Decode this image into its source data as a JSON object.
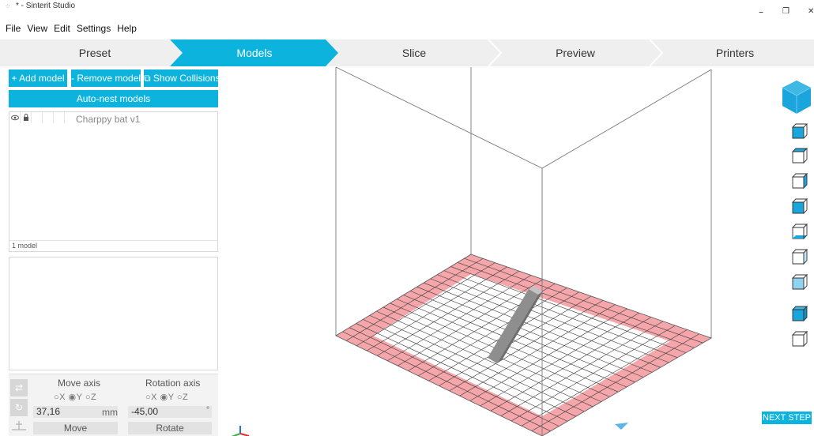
{
  "window": {
    "title": "* - Sinterit Studio",
    "app_icon": "app-icon",
    "minimize": "–",
    "restore": "❐",
    "close": "✕"
  },
  "menu": [
    "File",
    "View",
    "Edit",
    "Settings",
    "Help"
  ],
  "steps": {
    "items": [
      "Preset",
      "Models",
      "Slice",
      "Preview",
      "Printers"
    ],
    "active": "Models"
  },
  "toolbar": {
    "add_model": "+ Add model",
    "remove_model": "- Remove model",
    "show_collisions": "⧉ Show Collisions",
    "auto_nest": "Auto-nest models"
  },
  "model_list": {
    "models": [
      {
        "name": "Charppy bat v1"
      }
    ],
    "count_label": "1 model"
  },
  "transform": {
    "move_axis_label": "Move axis",
    "rotation_axis_label": "Rotation axis",
    "move_axes": "○X ◉Y ○Z",
    "rotation_axes": "○X ◉Y ○Z",
    "move_value": "37,16",
    "move_unit": "mm",
    "rotation_value": "-45,00",
    "rotation_unit": "°",
    "move_button": "Move",
    "rotate_button": "Rotate"
  },
  "viewport": {
    "view_cube_label": "view-cube",
    "next_step": "NEXT STEP"
  },
  "colors": {
    "accent": "#0cb3dd",
    "border_area": "#f4a6ab",
    "grid_line": "#3a3a3a",
    "model": "#9a9a9a"
  }
}
